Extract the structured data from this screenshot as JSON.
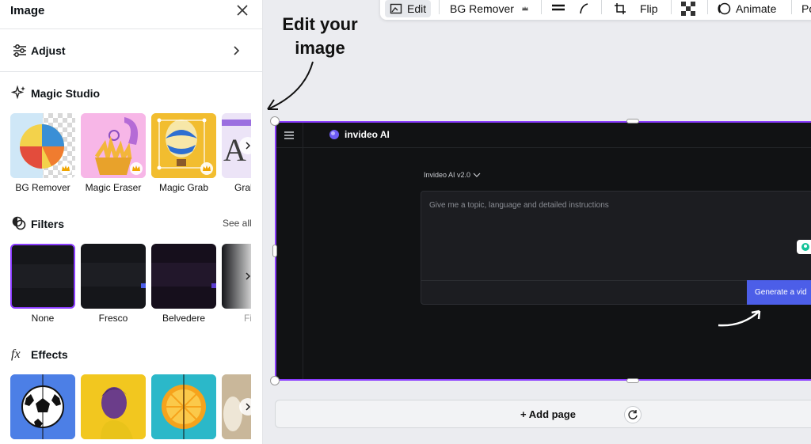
{
  "panel": {
    "title": "Image",
    "adjust_label": "Adjust",
    "magic_studio": {
      "title": "Magic Studio",
      "items": [
        {
          "label": "BG Remover",
          "icon": "bg-remover-thumb"
        },
        {
          "label": "Magic Eraser",
          "icon": "magic-eraser-thumb"
        },
        {
          "label": "Magic Grab",
          "icon": "magic-grab-thumb"
        },
        {
          "label": "Grab",
          "icon": "grab-text-thumb"
        }
      ]
    },
    "filters": {
      "title": "Filters",
      "see_all": "See all",
      "items": [
        {
          "label": "None"
        },
        {
          "label": "Fresco"
        },
        {
          "label": "Belvedere"
        },
        {
          "label": "Fi"
        }
      ]
    },
    "effects": {
      "title": "Effects",
      "items": [
        "soccer-ball-thumb",
        "portrait-thumb",
        "orange-thumb",
        "statue-thumb"
      ]
    }
  },
  "toolbar": {
    "edit_label": "Edit",
    "bg_remover_label": "BG Remover",
    "flip_label": "Flip",
    "animate_label": "Animate",
    "position_label": "Po"
  },
  "annotation": {
    "line1": "Edit your",
    "line2": "image"
  },
  "canvas": {
    "brand": "invideo AI",
    "version": "Invideo AI v2.0",
    "prompt_placeholder": "Give me a topic, language and detailed instructions",
    "generate_label": "Generate a vid"
  },
  "add_page_label": "+ Add page",
  "colors": {
    "accent": "#8b3dff",
    "generate": "#4c5ee8",
    "canvas_bg": "#111214"
  }
}
